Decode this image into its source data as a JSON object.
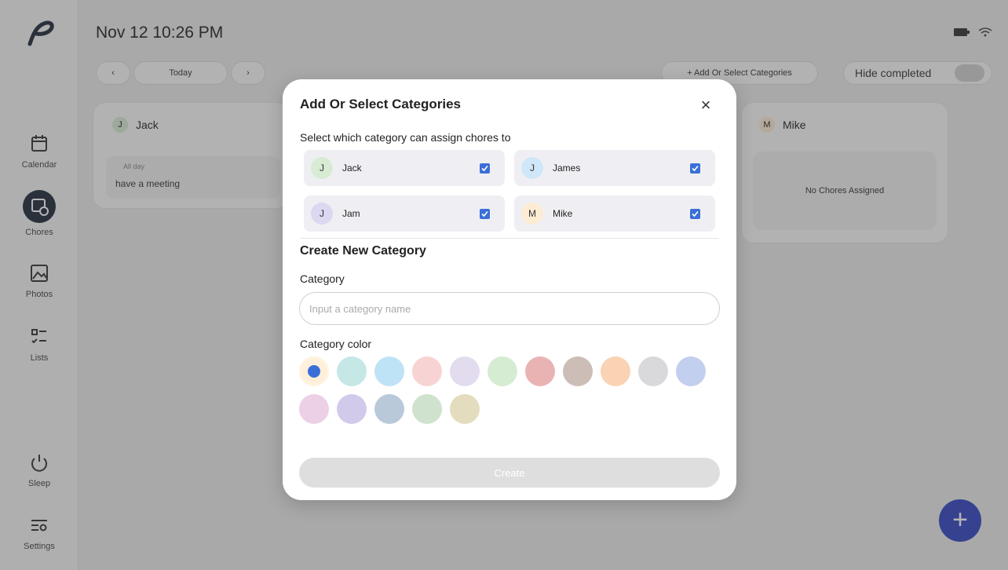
{
  "app": {
    "time": "Nov 12 10:26 PM",
    "nav": [
      {
        "label": "Calendar",
        "icon": "calendar-icon"
      },
      {
        "label": "Chores",
        "icon": "chores-icon"
      },
      {
        "label": "Photos",
        "icon": "photos-icon"
      },
      {
        "label": "Lists",
        "icon": "lists-icon"
      },
      {
        "label": "Sleep",
        "icon": "power-icon"
      },
      {
        "label": "Settings",
        "icon": "settings-icon"
      }
    ],
    "date_nav": {
      "today_label": "Today",
      "prev": "‹",
      "next": "›"
    },
    "add_categories_label": "+ Add Or Select Categories",
    "hide_completed_label": "Hide completed",
    "columns": [
      {
        "initial": "J",
        "name": "Jack",
        "event_time": "All day",
        "event_title": "have a meeting"
      },
      {
        "initial": "M",
        "name": "Mike",
        "empty_text": "No Chores Assigned"
      }
    ],
    "fab_label": "+"
  },
  "modal": {
    "title": "Add Or Select Categories",
    "close": "×",
    "subtitle": "Select which category can assign chores to",
    "categories": [
      {
        "initial": "J",
        "name": "Jack",
        "color": "#d8ecd5",
        "checked": true
      },
      {
        "initial": "J",
        "name": "James",
        "color": "#cfe7f8",
        "checked": true
      },
      {
        "initial": "J",
        "name": "Jam",
        "color": "#dcd8f1",
        "checked": true
      },
      {
        "initial": "M",
        "name": "Mike",
        "color": "#fdebd3",
        "checked": true
      }
    ],
    "create_section_title": "Create New Category",
    "category_label": "Category",
    "category_input": {
      "value": "",
      "placeholder": "Input a category name"
    },
    "color_label": "Category color",
    "colors": [
      "#fdefd9",
      "#c5e7e6",
      "#bfe3f6",
      "#f7d4d3",
      "#e3dcee",
      "#d6ecd2",
      "#eab3b3",
      "#cdbdb7",
      "#f9d3b3",
      "#d9d9dc",
      "#c3cfee",
      "#ecd0e6",
      "#d2caeb",
      "#b9c9d9",
      "#cfe2cd",
      "#e4dcbe"
    ],
    "selected_color_index": 0,
    "create_label": "Create"
  }
}
